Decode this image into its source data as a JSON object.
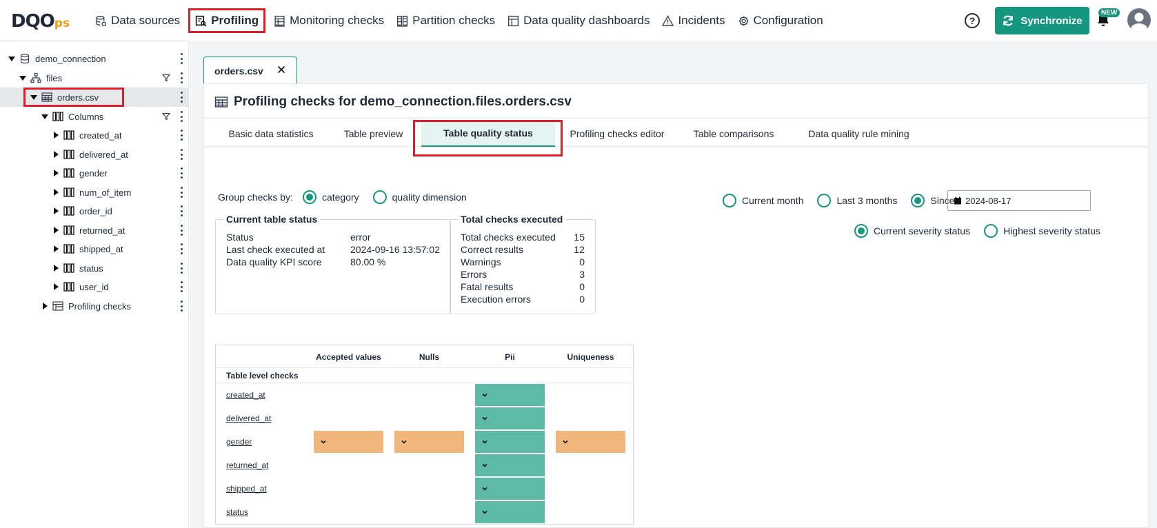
{
  "header": {
    "logo_main": "DQO",
    "logo_suffix": "ps",
    "nav": [
      {
        "label": "Data sources",
        "icon": "database-icon"
      },
      {
        "label": "Profiling",
        "icon": "profiling-icon",
        "active": true
      },
      {
        "label": "Monitoring checks",
        "icon": "table-icon"
      },
      {
        "label": "Partition checks",
        "icon": "partition-icon"
      },
      {
        "label": "Data quality dashboards",
        "icon": "dashboard-icon"
      },
      {
        "label": "Incidents",
        "icon": "warning-icon"
      },
      {
        "label": "Configuration",
        "icon": "gear-icon"
      }
    ],
    "help_label": "?",
    "sync_label": "Synchronize",
    "new_badge": "NEW"
  },
  "sidebar": {
    "items": [
      {
        "label": "demo_connection",
        "level": 0,
        "caret": "down",
        "icon": "database-icon"
      },
      {
        "label": "files",
        "level": 1,
        "caret": "down",
        "icon": "schema-icon",
        "filter": true
      },
      {
        "label": "orders.csv",
        "level": 2,
        "caret": "down",
        "icon": "table-icon",
        "selected": true
      },
      {
        "label": "Columns",
        "level": 3,
        "caret": "down",
        "icon": "columns-icon",
        "filter": true
      },
      {
        "label": "created_at",
        "level": 4,
        "caret": "right",
        "icon": "column-icon"
      },
      {
        "label": "delivered_at",
        "level": 4,
        "caret": "right",
        "icon": "column-icon"
      },
      {
        "label": "gender",
        "level": 4,
        "caret": "right",
        "icon": "column-icon"
      },
      {
        "label": "num_of_item",
        "level": 4,
        "caret": "right",
        "icon": "column-icon"
      },
      {
        "label": "order_id",
        "level": 4,
        "caret": "right",
        "icon": "column-icon"
      },
      {
        "label": "returned_at",
        "level": 4,
        "caret": "right",
        "icon": "column-icon"
      },
      {
        "label": "shipped_at",
        "level": 4,
        "caret": "right",
        "icon": "column-icon"
      },
      {
        "label": "status",
        "level": 4,
        "caret": "right",
        "icon": "column-icon"
      },
      {
        "label": "user_id",
        "level": 4,
        "caret": "right",
        "icon": "column-icon"
      },
      {
        "label": "Profiling checks",
        "level": 3,
        "caret": "right",
        "icon": "checks-icon"
      }
    ]
  },
  "main": {
    "file_tab": "orders.csv",
    "title": "Profiling checks for demo_connection.files.orders.csv",
    "subtabs": [
      "Basic data statistics",
      "Table preview",
      "Table quality status",
      "Profiling checks editor",
      "Table comparisons",
      "Data quality rule mining"
    ],
    "active_subtab": "Table quality status",
    "group_by": {
      "label": "Group checks by:",
      "options": [
        "category",
        "quality dimension"
      ],
      "selected": "category"
    },
    "period": {
      "options": [
        "Current month",
        "Last 3 months",
        "Since"
      ],
      "selected": "Since",
      "since_date": "2024-08-17"
    },
    "severity": {
      "options": [
        "Current severity status",
        "Highest severity status"
      ],
      "selected": "Current severity status"
    },
    "current_status": {
      "title": "Current table status",
      "rows": [
        {
          "k": "Status",
          "v": "error"
        },
        {
          "k": "Last check executed at",
          "v": "2024-09-16 13:57:02"
        },
        {
          "k": "Data quality KPI score",
          "v": "80.00 %"
        }
      ]
    },
    "total_checks": {
      "title": "Total checks executed",
      "rows": [
        {
          "k": "Total checks executed",
          "v": "15"
        },
        {
          "k": "Correct results",
          "v": "12"
        },
        {
          "k": "Warnings",
          "v": "0"
        },
        {
          "k": "Errors",
          "v": "3"
        },
        {
          "k": "Fatal results",
          "v": "0"
        },
        {
          "k": "Execution errors",
          "v": "0"
        }
      ]
    },
    "grid": {
      "columns": [
        "Accepted values",
        "Nulls",
        "Pii",
        "Uniqueness"
      ],
      "group_label": "Table level checks",
      "rows": [
        {
          "name": "created_at",
          "cells": [
            "",
            "",
            "valid",
            ""
          ]
        },
        {
          "name": "delivered_at",
          "cells": [
            "",
            "",
            "valid",
            ""
          ]
        },
        {
          "name": "gender",
          "cells": [
            "error",
            "error",
            "valid",
            "error"
          ]
        },
        {
          "name": "returned_at",
          "cells": [
            "",
            "",
            "valid",
            ""
          ]
        },
        {
          "name": "shipped_at",
          "cells": [
            "",
            "",
            "valid",
            ""
          ]
        },
        {
          "name": "status",
          "cells": [
            "",
            "",
            "valid",
            ""
          ]
        }
      ]
    },
    "colors": {
      "valid": "#5cbaa7",
      "error": "#f1b67b",
      "accent": "#14967f",
      "highlight": "#e11d2a"
    }
  }
}
